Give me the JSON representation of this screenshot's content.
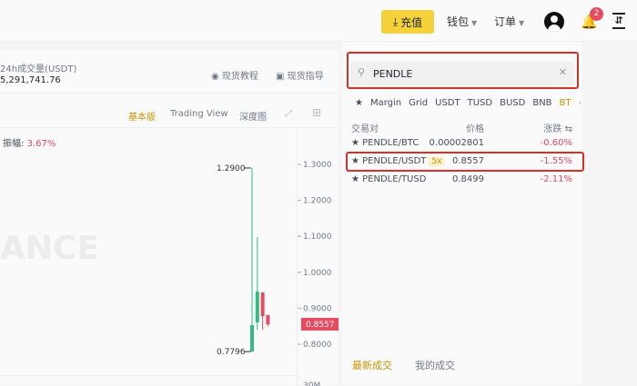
{
  "topbar": {
    "deposit": "充值",
    "wallet": "钱包",
    "orders": "订单",
    "notifications": "2"
  },
  "header": {
    "volume_label": "24h成交量(USDT)",
    "volume_value": "5,291,741.76",
    "tutorial": "现货教程",
    "guide": "现货指导"
  },
  "chart_toolbar": {
    "basic": "基本版",
    "tradingview": "Trading View",
    "depth": "深度图"
  },
  "chart": {
    "amplitude_label": "振幅:",
    "amplitude_value": "3.67%",
    "watermark": "ANCE",
    "high_label": "1.2900",
    "low_label": "0.7796",
    "current_price": "0.8557",
    "y_ticks": [
      "1.3000",
      "1.2000",
      "1.1000",
      "1.0000",
      "0.9000",
      "0.8000"
    ],
    "volume_tick": "30M",
    "candles": [
      {
        "o": 0.7796,
        "h": 1.29,
        "l": 0.7796,
        "c": 0.853
      },
      {
        "o": 0.861,
        "h": 1.098,
        "l": 0.84,
        "c": 0.946
      },
      {
        "o": 0.944,
        "h": 0.944,
        "l": 0.84,
        "c": 0.878
      },
      {
        "o": 0.881,
        "h": 0.881,
        "l": 0.85,
        "c": 0.855
      }
    ],
    "colors": {
      "up": "#2ebd85",
      "down": "#e84a5f"
    }
  },
  "market": {
    "search_value": "PENDLE",
    "tabs": [
      "Margin",
      "Grid",
      "USDT",
      "TUSD",
      "BUSD",
      "BNB",
      "BT"
    ],
    "headers": {
      "pair": "交易对",
      "price": "价格",
      "change": "涨跌"
    },
    "rows": [
      {
        "pair": "PENDLE/BTC",
        "price": "0.00002801",
        "change": "-0.60%"
      },
      {
        "pair": "PENDLE/USDT",
        "leverage": "5x",
        "price": "0.8557",
        "change": "-1.55%"
      },
      {
        "pair": "PENDLE/TUSD",
        "price": "0.8499",
        "change": "-2.11%"
      }
    ]
  },
  "trades": {
    "latest": "最新成交",
    "mine": "我的成交"
  }
}
